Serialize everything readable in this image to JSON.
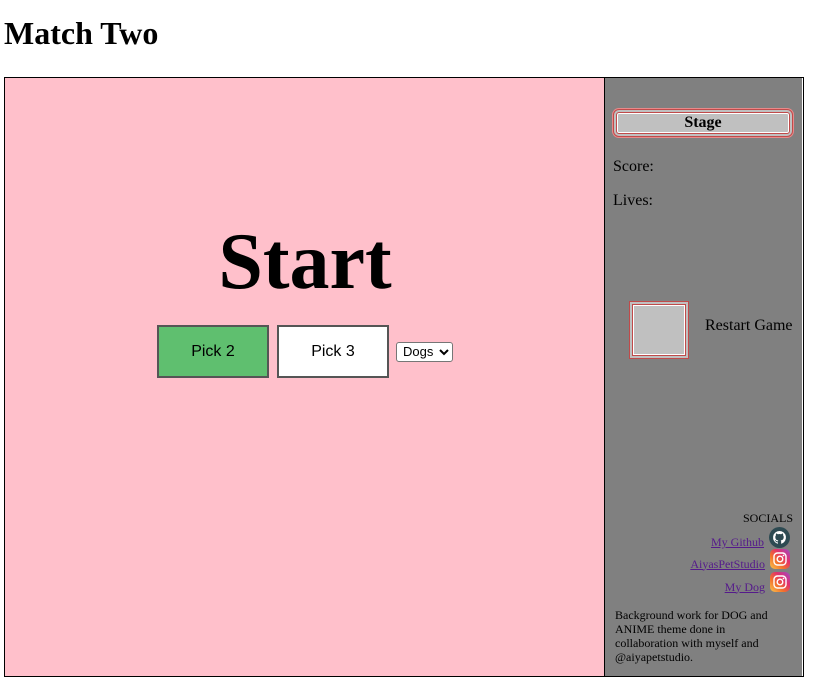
{
  "page": {
    "title": "Match Two"
  },
  "board": {
    "heading": "Start",
    "pick2_label": "Pick 2",
    "pick3_label": "Pick 3",
    "theme_select": {
      "selected": "Dogs"
    }
  },
  "side": {
    "stage_label": "Stage",
    "score_label": "Score:",
    "lives_label": "Lives:",
    "restart_label": "Restart Game",
    "socials": {
      "heading": "SOCIALS",
      "links": [
        {
          "label": "My Github",
          "icon": "github-icon"
        },
        {
          "label": "AiyasPetStudio",
          "icon": "instagram-icon"
        },
        {
          "label": "My Dog",
          "icon": "instagram-icon"
        }
      ]
    },
    "credit": "Background work for DOG and ANIME theme done in collaboration with myself and @aiyapetstudio."
  },
  "colors": {
    "board_bg": "#ffc0cb",
    "side_bg": "#808080",
    "pick2_bg": "#5fbf6f",
    "accent_border": "#c04a4a",
    "link": "#551a8b"
  }
}
